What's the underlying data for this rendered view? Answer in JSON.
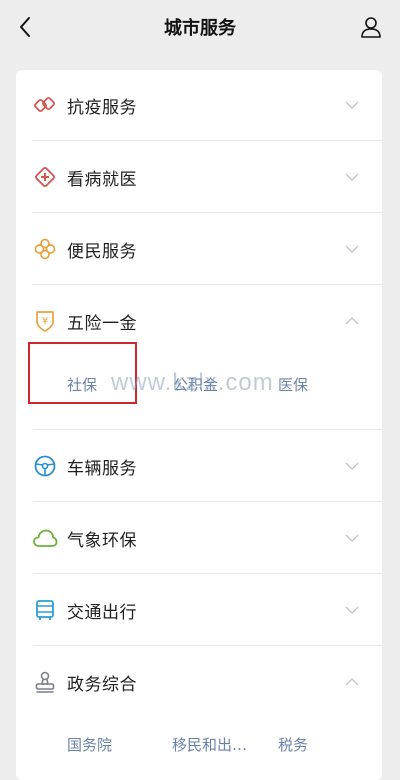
{
  "header": {
    "title": "城市服务",
    "back_icon": "chevron-left-icon",
    "user_icon": "user-icon"
  },
  "categories": [
    {
      "label": "抗疫服务",
      "icon": "epidemic-icon",
      "color": "#d9534f",
      "expanded": false
    },
    {
      "label": "看病就医",
      "icon": "medical-cross-icon",
      "color": "#d9534f",
      "expanded": false
    },
    {
      "label": "便民服务",
      "icon": "flower-icon",
      "color": "#e9a23b",
      "expanded": false
    },
    {
      "label": "五险一金",
      "icon": "yuan-shield-icon",
      "color": "#e9a23b",
      "expanded": true,
      "items": [
        "社保",
        "公积金",
        "医保"
      ]
    },
    {
      "label": "车辆服务",
      "icon": "steering-wheel-icon",
      "color": "#2a8fcf",
      "expanded": false
    },
    {
      "label": "气象环保",
      "icon": "cloud-icon",
      "color": "#6bb33c",
      "expanded": false
    },
    {
      "label": "交通出行",
      "icon": "bus-icon",
      "color": "#2a9fd6",
      "expanded": false
    },
    {
      "label": "政务综合",
      "icon": "stamp-icon",
      "color": "#7a7f88",
      "expanded": true,
      "items": [
        "国务院",
        "移民和出…",
        "税务"
      ]
    }
  ],
  "watermark": "www.kzlx.com",
  "colors": {
    "background": "#ededed",
    "card": "#ffffff",
    "sub_link": "#6b82a8",
    "highlight": "#d0262b"
  }
}
